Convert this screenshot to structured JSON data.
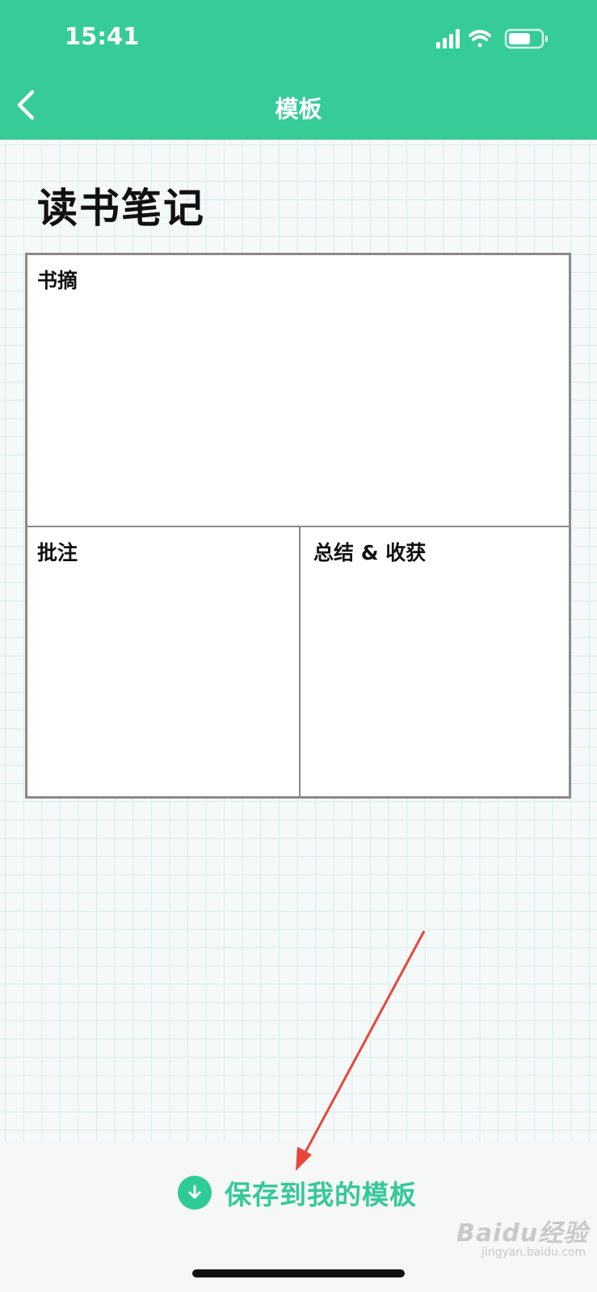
{
  "status_bar": {
    "time": "15:41"
  },
  "nav": {
    "title": "模板"
  },
  "template": {
    "title": "读书笔记",
    "sections": [
      "书摘",
      "批注",
      "总结 & 收获"
    ]
  },
  "actions": {
    "save_label": "保存到我的模板"
  },
  "watermark": {
    "brand": "Baidu经验",
    "url": "jingyan.baidu.com"
  },
  "colors": {
    "accent": "#35cc98",
    "annotation_arrow": "#e8463c"
  }
}
